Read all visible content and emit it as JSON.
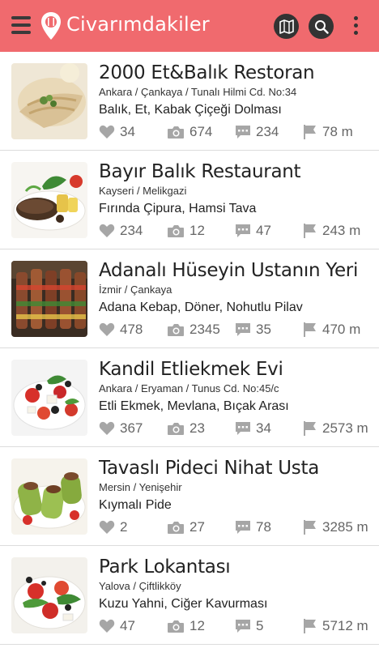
{
  "app": {
    "title": "Civarımdakiler",
    "icons": {
      "menu": "hamburger-menu-icon",
      "logo": "location-pin-logo-icon",
      "map": "map-icon",
      "search": "search-icon",
      "overflow": "more-vertical-icon"
    },
    "colors": {
      "appbar": "#f06a6e",
      "button": "#333333",
      "stat_icon": "#a6a6a6"
    }
  },
  "restaurants": [
    {
      "name": "2000 Et&Balık Restoran",
      "location": "Ankara / Çankaya / Tunalı Hilmi Cd. No:34",
      "dishes": "Balık, Et, Kabak Çiçeği Dolması",
      "likes": "34",
      "photos": "674",
      "comments": "234",
      "distance": "78 m"
    },
    {
      "name": "Bayır Balık Restaurant",
      "location": "Kayseri / Melikgazi",
      "dishes": "Fırında Çipura, Hamsi Tava",
      "likes": "234",
      "photos": "12",
      "comments": "47",
      "distance": "243 m"
    },
    {
      "name": "Adanalı Hüseyin Ustanın Yeri",
      "location": "İzmir / Çankaya",
      "dishes": "Adana Kebap, Döner, Nohutlu Pilav",
      "likes": "478",
      "photos": "2345",
      "comments": "35",
      "distance": "470 m"
    },
    {
      "name": "Kandil Etliekmek Evi",
      "location": "Ankara / Eryaman / Tunus Cd. No:45/c",
      "dishes": "Etli Ekmek, Mevlana, Bıçak Arası",
      "likes": "367",
      "photos": "23",
      "comments": "34",
      "distance": "2573 m"
    },
    {
      "name": "Tavaslı Pideci Nihat Usta",
      "location": "Mersin / Yenişehir",
      "dishes": "Kıymalı Pide",
      "likes": "2",
      "photos": "27",
      "comments": "78",
      "distance": "3285 m"
    },
    {
      "name": "Park Lokantası",
      "location": "Yalova / Çiftlikköy",
      "dishes": "Kuzu Yahni, Ciğer Kavurması",
      "likes": "47",
      "photos": "12",
      "comments": "5",
      "distance": "5712 m"
    }
  ],
  "stat_icons": {
    "likes": "heart-icon",
    "photos": "camera-icon",
    "comments": "comment-icon",
    "distance": "flag-icon"
  }
}
